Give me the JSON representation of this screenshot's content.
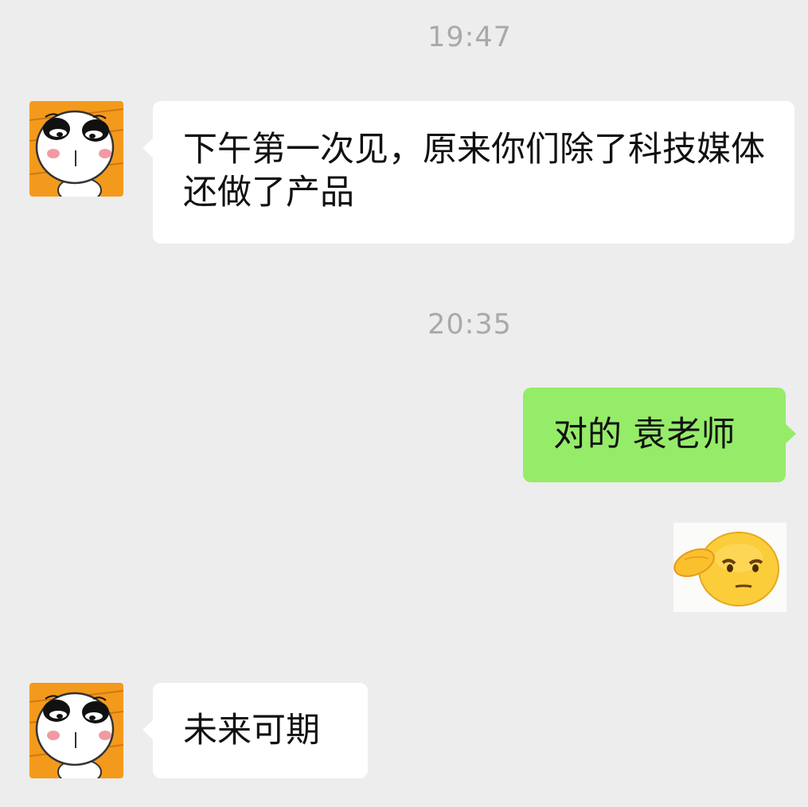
{
  "chat": {
    "timestamp_1": "19:47",
    "timestamp_2": "20:35",
    "messages": [
      {
        "text": "下午第一次见，原来你们除了科技媒体还做了产品"
      },
      {
        "text": "对的 袁老师"
      },
      {
        "sticker": "salute-emoji"
      },
      {
        "text": "未来可期"
      }
    ]
  },
  "icons": {
    "incoming_avatar": "panda-avatar-icon",
    "sticker": "salute-emoji-icon"
  },
  "colors": {
    "background": "#ededed",
    "incoming_bubble": "#ffffff",
    "outgoing_bubble": "#95ec69",
    "timestamp_text": "#a9a9a9"
  }
}
